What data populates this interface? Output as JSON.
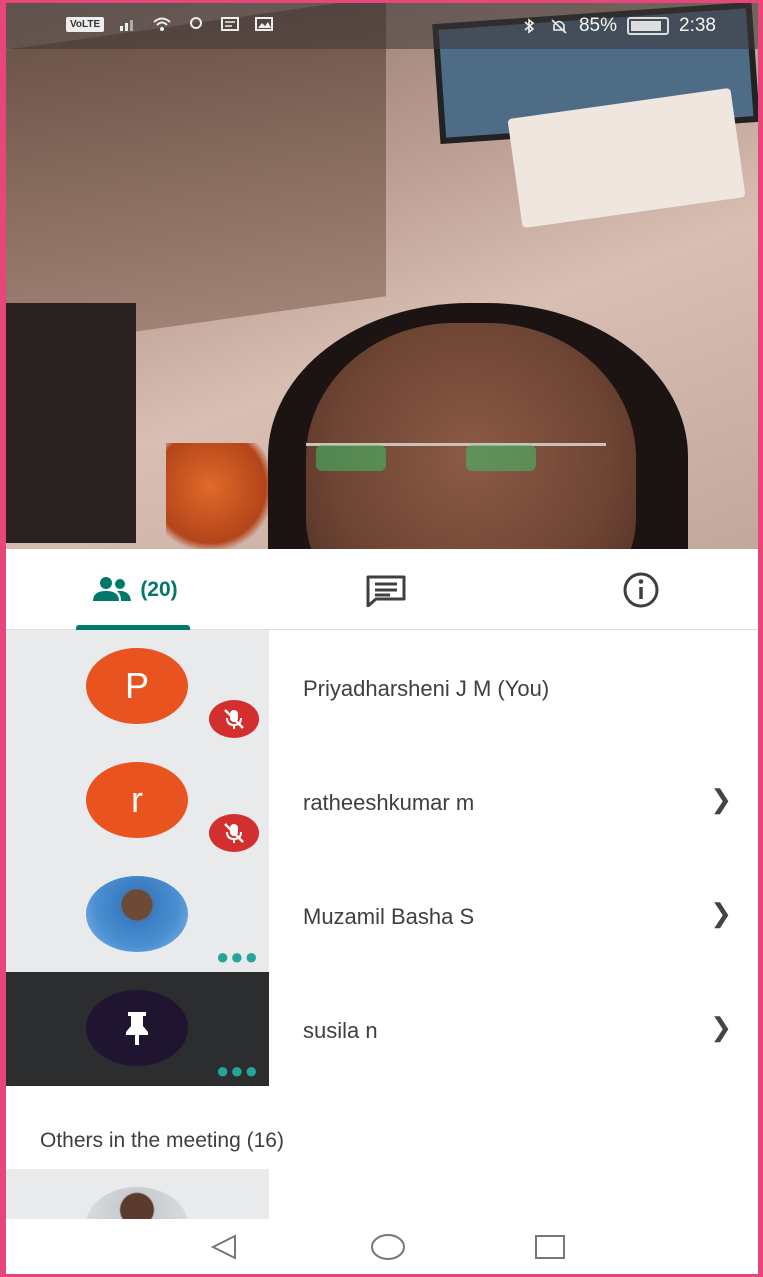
{
  "status_bar": {
    "volte": "VoLTE",
    "battery": "85%",
    "time": "2:38"
  },
  "tabs": {
    "people_count": "(20)",
    "people_icon": "people-icon",
    "chat_icon": "chat-icon",
    "info_icon": "info-icon"
  },
  "participants": [
    {
      "initial": "P",
      "name": "Priyadharsheni J M (You)",
      "muted": true
    },
    {
      "initial": "r",
      "name": "ratheeshkumar m",
      "muted": true
    },
    {
      "initial": "",
      "name": "Muzamil Basha S",
      "muted": false
    },
    {
      "initial": "",
      "name": "susila n",
      "muted": false
    }
  ],
  "others": {
    "title": "Others in the meeting (16)"
  },
  "colors": {
    "accent": "#00796b",
    "avatar_orange": "#e8531f",
    "mute_red": "#d32f2f"
  }
}
